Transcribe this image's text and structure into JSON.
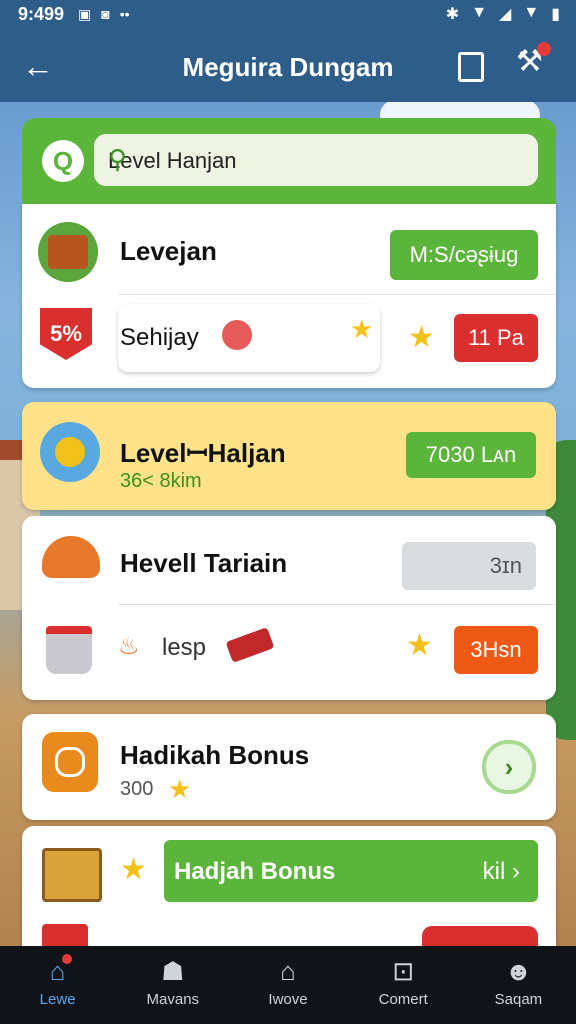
{
  "status_bar": {
    "time": "9:499",
    "left_icons": [
      "▣",
      "◙",
      "••"
    ],
    "right_icons": [
      "✱",
      "▼",
      "◢",
      "▼",
      "▮"
    ]
  },
  "app_bar": {
    "title": "Meguira Dungam"
  },
  "search": {
    "value": "Level Hanjan"
  },
  "card1": {
    "row1": {
      "title": "Levejan",
      "button": "M:S/cəʂɨug"
    },
    "row2": {
      "badge_text": "5%",
      "text": "Sehijay",
      "button": "11 Pa"
    }
  },
  "card2": {
    "title": "LevelꟷHaljan",
    "subtitle": "36< 8kim",
    "button": "7030 Lᴀn"
  },
  "card3": {
    "row1": {
      "title": "Hevell Tariain",
      "button": "3ɪn"
    },
    "row2": {
      "text": "lesp",
      "button": "3Hsn"
    }
  },
  "card4": {
    "title": "Hadikah Bonus",
    "value": "300"
  },
  "card5": {
    "button_label": "Hadjah Bonus",
    "button_right": "kil ›"
  },
  "nav": [
    {
      "label": "Lewe",
      "icon": "⌂",
      "active": true
    },
    {
      "label": "Mavans",
      "icon": "☗"
    },
    {
      "label": "Iwove",
      "icon": "⌂"
    },
    {
      "label": "Comert",
      "icon": "⊡"
    },
    {
      "label": "Saqam",
      "icon": "☻"
    }
  ],
  "colors": {
    "appbar": "#2f5d8a",
    "green": "#5bb53a",
    "red": "#d9302f",
    "orange": "#ee5a16",
    "yellow_card": "#fde28a"
  }
}
